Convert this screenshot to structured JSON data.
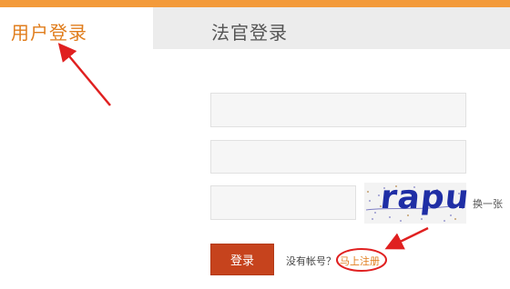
{
  "tabs": {
    "user_login": "用户登录",
    "judge_login": "法官登录"
  },
  "form": {
    "username_value": "",
    "password_value": "",
    "captcha_value": "",
    "captcha_image_text": "rapu",
    "refresh_captcha": "换一张",
    "login_button": "登录",
    "no_account": "没有帐号？",
    "register_link": "马上注册"
  },
  "colors": {
    "accent": "#e07d1c",
    "login_button": "#c6431d",
    "annotation": "#e02020",
    "top_bar": "#f39a3a"
  }
}
